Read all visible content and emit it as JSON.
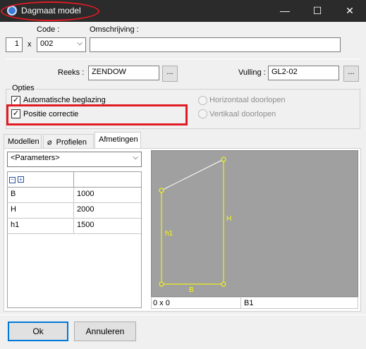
{
  "window": {
    "title": "Dagmaat model",
    "minimize": "—",
    "maximize": "☐",
    "close": "✕"
  },
  "header": {
    "quantity": "1",
    "times": "x",
    "code_label": "Code :",
    "code_value": "002",
    "omschrijving_label": "Omschrijving :",
    "omschrijving_value": ""
  },
  "series": {
    "reeks_label": "Reeks :",
    "reeks_value": "ZENDOW",
    "browse": "...",
    "vulling_label": "Vulling :",
    "vulling_value": "GL2-02"
  },
  "options": {
    "legend": "Opties",
    "automatic_glazing": {
      "label": "Automatische beglazing",
      "checked": true
    },
    "position_correction": {
      "label": "Positie correctie",
      "checked": true
    },
    "horizontal": {
      "label": "Horizontaal doorlopen",
      "enabled": false
    },
    "vertical": {
      "label": "Vertikaal doorlopen",
      "enabled": false
    }
  },
  "tabs": [
    {
      "label": "Modellen"
    },
    {
      "label": "Profielen"
    },
    {
      "label": "Afmetingen"
    }
  ],
  "parameters": {
    "dropdown": "<Parameters>",
    "rows": [
      {
        "name": "B",
        "value": "1000"
      },
      {
        "name": "H",
        "value": "2000"
      },
      {
        "name": "h1",
        "value": "1500"
      }
    ]
  },
  "preview": {
    "labels": {
      "h1": "h1",
      "H": "H",
      "B": "B"
    },
    "status_left": "0 x 0",
    "status_right": "B1"
  },
  "footer": {
    "ok": "Ok",
    "cancel": "Annuleren"
  }
}
